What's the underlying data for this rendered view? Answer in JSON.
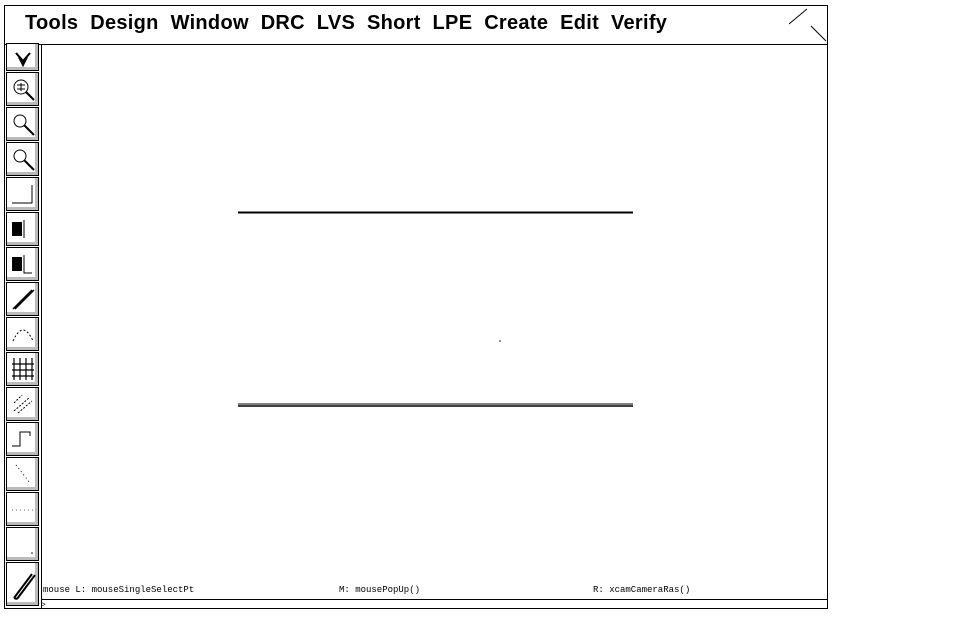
{
  "menu": {
    "items": [
      "Tools",
      "Design",
      "Window",
      "DRC",
      "LVS",
      "Short",
      "LPE",
      "Create",
      "Edit",
      "Verify"
    ]
  },
  "toolbar": {
    "tools": [
      {
        "icon": "redraw-icon"
      },
      {
        "icon": "zoom-fit-icon"
      },
      {
        "icon": "zoom-in-icon"
      },
      {
        "icon": "zoom-out-icon"
      },
      {
        "icon": "rectangle-icon"
      },
      {
        "icon": "layer-fill-icon"
      },
      {
        "icon": "layer-stack-icon"
      },
      {
        "icon": "wire-icon"
      },
      {
        "icon": "arc-icon"
      },
      {
        "icon": "grid-icon"
      },
      {
        "icon": "instance-icon"
      },
      {
        "icon": "path-icon"
      },
      {
        "icon": "diagonal-icon"
      },
      {
        "icon": "dots-icon"
      },
      {
        "icon": "blank-icon"
      },
      {
        "icon": "pen-icon"
      }
    ]
  },
  "status": {
    "left": "mouse L: mouseSingleSelectPt",
    "middle": "M: mousePopUp()",
    "right": "R: xcamCameraRas()"
  },
  "command_prompt": ">"
}
